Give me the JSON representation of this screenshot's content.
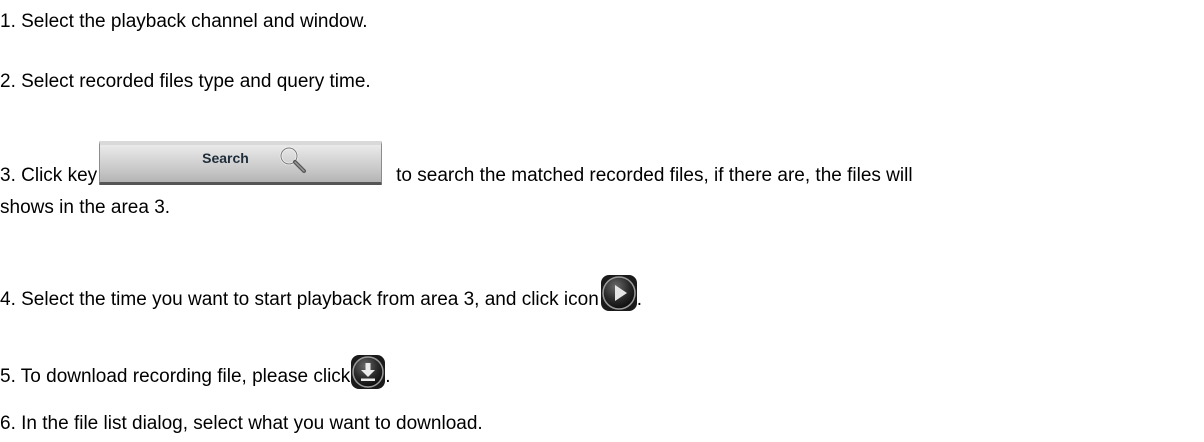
{
  "steps": {
    "step1": "1. Select the playback channel and window.",
    "step2": "2. Select recorded files type and query time.",
    "step3_before": "3. Click key",
    "step3_after": "to search the matched recorded files, if there are, the files will",
    "step3_cont": "shows in the area 3.",
    "step4_before": "4. Select the time you want to start playback from area 3, and click icon",
    "step4_after": ".",
    "step5_before": "5. To download recording file, please click",
    "step5_after": ".",
    "step6": "6. In the file list dialog, select what you want to download."
  },
  "search_key": {
    "label": "Search",
    "icon": "magnifier-icon"
  },
  "icons": {
    "play": "play-icon",
    "download": "download-icon"
  },
  "colors": {
    "text": "#000000",
    "button_face": "#c6c6c6",
    "icon_dark": "#2b2b2b"
  }
}
